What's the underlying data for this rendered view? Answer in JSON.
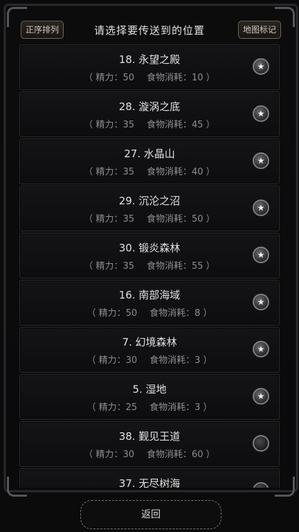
{
  "header": {
    "sort_label": "正序排列",
    "title": "请选择要传送到的位置",
    "map_mark_label": "地图标记"
  },
  "labels": {
    "stamina_prefix": "（ 精力：",
    "food_prefix": "食物消耗：",
    "suffix": " ）"
  },
  "locations": [
    {
      "name": "18. 永望之殿",
      "stamina": "50",
      "food": "10",
      "starred": true
    },
    {
      "name": "28. 漩涡之底",
      "stamina": "35",
      "food": "45",
      "starred": true
    },
    {
      "name": "27. 水晶山",
      "stamina": "35",
      "food": "40",
      "starred": true
    },
    {
      "name": "29. 沉沦之沼",
      "stamina": "35",
      "food": "50",
      "starred": true
    },
    {
      "name": "30. 锻炎森林",
      "stamina": "35",
      "food": "55",
      "starred": true
    },
    {
      "name": "16. 南部海域",
      "stamina": "50",
      "food": "8",
      "starred": true
    },
    {
      "name": "7. 幻境森林",
      "stamina": "30",
      "food": "3",
      "starred": true
    },
    {
      "name": "5. 湿地",
      "stamina": "25",
      "food": "3",
      "starred": true
    },
    {
      "name": "38. 觐见王道",
      "stamina": "30",
      "food": "60",
      "starred": false
    },
    {
      "name": "37. 无尽树海",
      "stamina": "",
      "food": "",
      "starred": false
    }
  ],
  "icons": {
    "star": "star-icon"
  },
  "footer": {
    "back_label": "返回"
  }
}
